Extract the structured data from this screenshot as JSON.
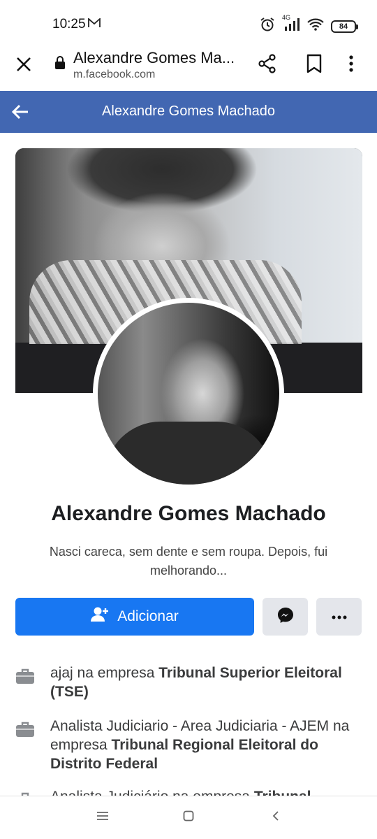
{
  "status_bar": {
    "time": "10:25",
    "network": "4G",
    "battery": "84"
  },
  "browser": {
    "page_title": "Alexandre Gomes Ma...",
    "url": "m.facebook.com"
  },
  "fb_header": {
    "title": "Alexandre Gomes Machado",
    "color": "#4267b2"
  },
  "profile": {
    "name": "Alexandre Gomes Machado",
    "bio": "Nasci careca, sem dente e sem roupa. Depois, fui melhorando..."
  },
  "actions": {
    "add_label": "Adicionar",
    "add_color": "#1877f2"
  },
  "work": [
    {
      "prefix": "ajaj na empresa ",
      "company": "Tribunal Superior Eleitoral (TSE)"
    },
    {
      "prefix": "Analista Judiciario - Area Judiciaria - AJEM na empresa ",
      "company": "Tribunal Regional Eleitoral do Distrito Federal"
    },
    {
      "prefix": "Analista Judiciário na empresa ",
      "company": "Tribunal"
    }
  ]
}
